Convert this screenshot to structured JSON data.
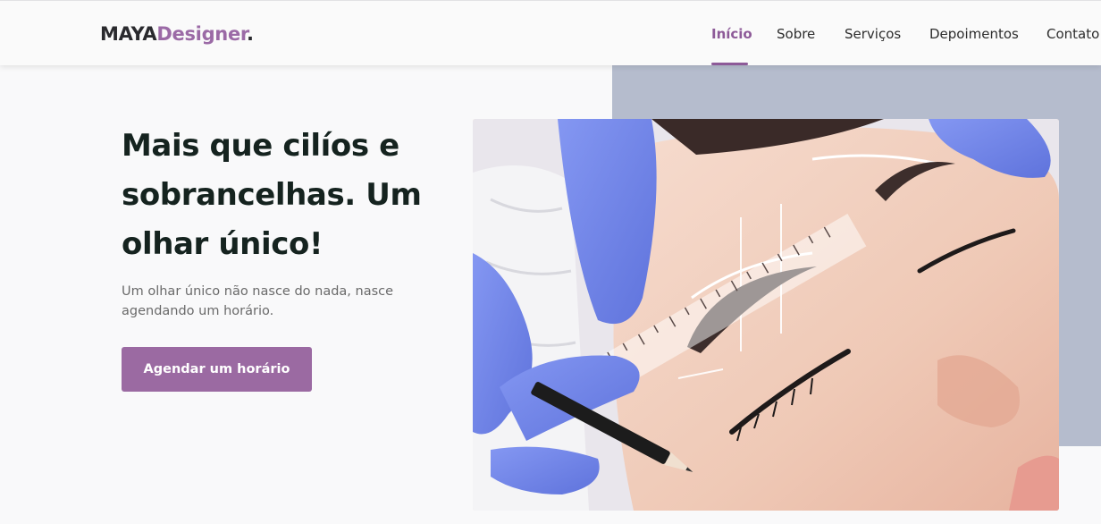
{
  "header": {
    "logo": {
      "part1": "MAYA",
      "part2": "Designer",
      "dot": "."
    },
    "nav": [
      {
        "label": "Início",
        "active": true
      },
      {
        "label": "Sobre",
        "active": false
      },
      {
        "label": "Serviços",
        "active": false
      },
      {
        "label": "Depoimentos",
        "active": false
      },
      {
        "label": "Contato",
        "active": false
      }
    ]
  },
  "hero": {
    "title": "Mais que cilíos e sobrancelhas. Um olhar único!",
    "subtitle": "Um olhar único não nasce do nada, nasce agendando um horário.",
    "cta_label": "Agendar um horário"
  },
  "colors": {
    "brand_purple": "#9b6aa6",
    "nav_active": "#8d5a98",
    "heading_dark": "#15231f",
    "side_block": "#b5bccd"
  },
  "icons": []
}
